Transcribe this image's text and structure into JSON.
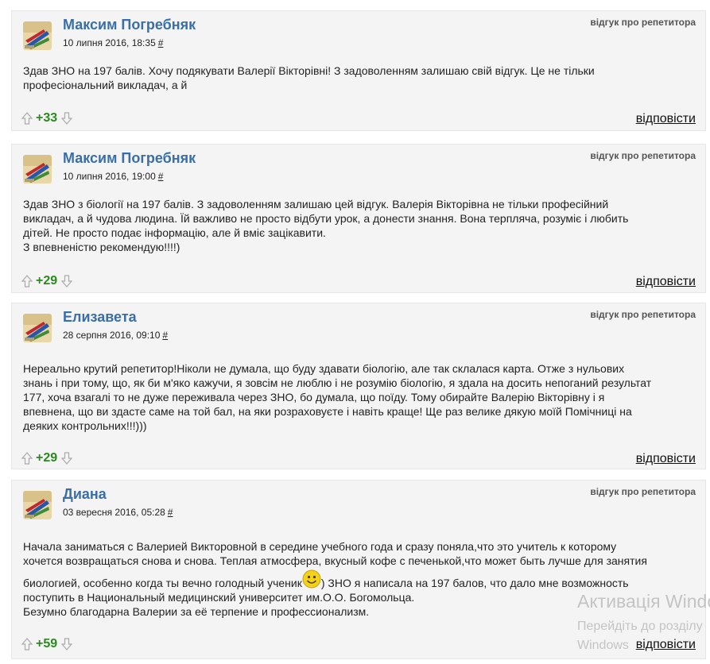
{
  "reviews": [
    {
      "author": "Максим Погребняк",
      "date": "10 липня 2016, 18:35",
      "hash": "#",
      "type": "відгук про репетитора",
      "lines": [
        "Здав ЗНО на 197 балів. Хочу подякувати Валерії Вікторівні! З задоволенням залишаю свій відгук. Це не тільки",
        "професіональний викладач, а й"
      ],
      "score": "+33",
      "reply": "відповісти"
    },
    {
      "author": "Максим Погребняк",
      "date": "10 липня 2016, 19:00",
      "hash": "#",
      "type": "відгук про репетитора",
      "lines": [
        "Здав ЗНО з біології на 197 балів. З задоволенням залишаю цей відгук. Валерія Вікторівна не тільки професійний",
        "викладач, а й чудова людина. Їй важливо не просто відбути урок, а донести знання. Вона терпляча, розуміє і любить",
        "дітей. Не просто подає інформацію, але й вміє зацікавити.",
        "З впевненістю рекомендую!!!!)"
      ],
      "score": "+29",
      "reply": "відповісти"
    },
    {
      "author": "Елизавета",
      "date": "28 серпня 2016, 09:10",
      "hash": "#",
      "type": "відгук про репетитора",
      "lines": [
        "Нереально крутий репетитор!Ніколи не думала, що буду здавати біологію, але так склалася карта. Отже з нульових",
        "знань і при тому, що, як би м'яко кажучи, я зовсім не люблю і не розумію біологію, я здала на досить непоганий результат",
        "177, хоча взагалі то не дуже переживала через ЗНО, бо думала, що поїду. Тому обирайте Валерію Вікторівну і я",
        "впевнена, що ви здасте саме на той бал, на яки розраховуєте і навіть краще! Ще раз велике дякую моїй Помічниці на",
        "деяких контрольних!!!)))"
      ],
      "score": "+29",
      "reply": "відповісти"
    },
    {
      "author": "Диана",
      "date": "03 вересня 2016, 05:28",
      "hash": "#",
      "type": "відгук про репетитора",
      "lines": [
        "Начала заниматься с Валерией Викторовной в середине учебного года и сразу поняла,что это учитель к которому",
        "хочется возвращаться снова и снова. Теплая атмосфера, вкусный кофе с печенькой,что может быть лучше для занятия"
      ],
      "smiley_before": "биологией, особенно когда ты вечно голодный ученик",
      "smiley_after": ") ЗНО я написала на 197 балов, что дало мне возможность",
      "lines_after": [
        "поступить в Национальный медицинский университет им.О.О. Богомольца.",
        "Безумно благодарна Валерии за её терпение и профессионализм."
      ],
      "score": "+59",
      "reply": "відповісти"
    }
  ],
  "watermark": {
    "line1": "Активація Windows",
    "line2": "Перейдіть до розділу",
    "line3": "Windows"
  },
  "icons": {
    "upvote": "arrow-up-outline",
    "downvote": "arrow-down-outline",
    "smiley": "smiley-face"
  },
  "colors": {
    "author": "#3a6ea8",
    "score": "#2a8a1e",
    "card_bg": "#f4f4f4"
  }
}
